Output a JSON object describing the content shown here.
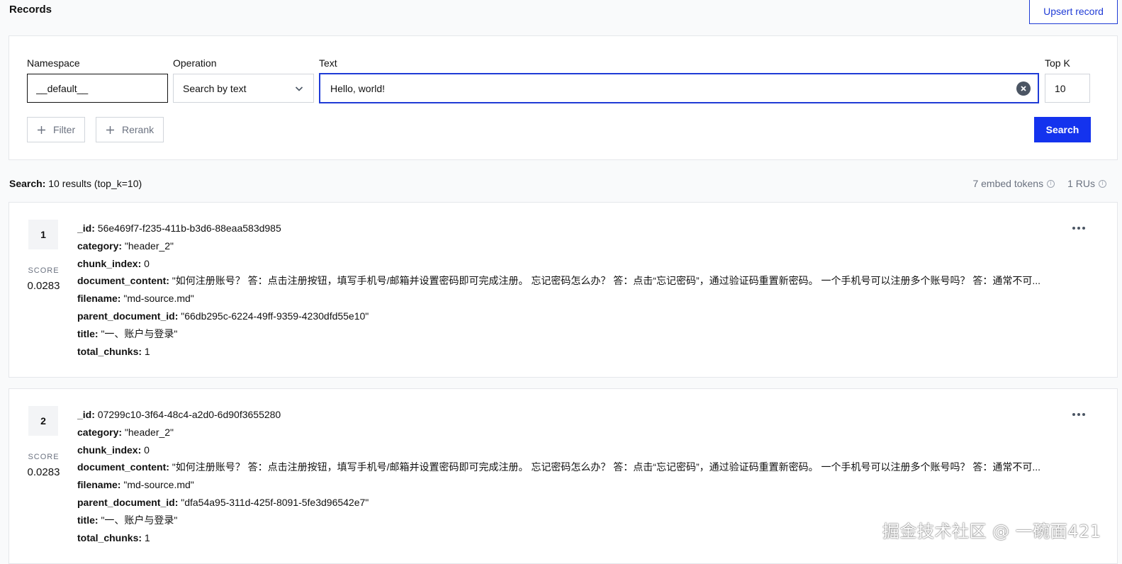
{
  "page": {
    "title": "Records",
    "upsert_label": "Upsert record"
  },
  "query": {
    "namespace_label": "Namespace",
    "namespace_value": "__default__",
    "operation_label": "Operation",
    "operation_value": "Search by text",
    "text_label": "Text",
    "text_value": "Hello, world!",
    "topk_label": "Top K",
    "topk_value": "10",
    "filter_label": "Filter",
    "rerank_label": "Rerank",
    "search_label": "Search"
  },
  "summary": {
    "prefix": "Search:",
    "text": " 10 results (top_k=10)",
    "embed_tokens": "7 embed tokens",
    "rus": "1 RUs"
  },
  "results": [
    {
      "rank": "1",
      "score_label": "SCORE",
      "score": "0.0283",
      "fields": [
        {
          "key": "_id:",
          "value": " 56e469f7-f235-411b-b3d6-88eaa583d985"
        },
        {
          "key": "category:",
          "value": " \"header_2\""
        },
        {
          "key": "chunk_index:",
          "value": " 0"
        },
        {
          "key": "document_content:",
          "value": " \"如何注册账号？ 答：点击注册按钮，填写手机号/邮箱并设置密码即可完成注册。 忘记密码怎么办？ 答：点击“忘记密码”，通过验证码重置新密码。 一个手机号可以注册多个账号吗？ 答：通常不可..."
        },
        {
          "key": "filename:",
          "value": " \"md-source.md\""
        },
        {
          "key": "parent_document_id:",
          "value": " \"66db295c-6224-49ff-9359-4230dfd55e10\""
        },
        {
          "key": "title:",
          "value": " \"一、账户与登录\""
        },
        {
          "key": "total_chunks:",
          "value": " 1"
        }
      ]
    },
    {
      "rank": "2",
      "score_label": "SCORE",
      "score": "0.0283",
      "fields": [
        {
          "key": "_id:",
          "value": " 07299c10-3f64-48c4-a2d0-6d90f3655280"
        },
        {
          "key": "category:",
          "value": " \"header_2\""
        },
        {
          "key": "chunk_index:",
          "value": " 0"
        },
        {
          "key": "document_content:",
          "value": " \"如何注册账号？ 答：点击注册按钮，填写手机号/邮箱并设置密码即可完成注册。 忘记密码怎么办？ 答：点击“忘记密码”，通过验证码重置新密码。 一个手机号可以注册多个账号吗？ 答：通常不可..."
        },
        {
          "key": "filename:",
          "value": " \"md-source.md\""
        },
        {
          "key": "parent_document_id:",
          "value": " \"dfa54a95-311d-425f-8091-5fe3d96542e7\""
        },
        {
          "key": "title:",
          "value": " \"一、账户与登录\""
        },
        {
          "key": "total_chunks:",
          "value": " 1"
        }
      ]
    }
  ],
  "watermark": "掘金技术社区 @ 一碗面421",
  "colors": {
    "accent": "#1433ee",
    "border_accent": "#1f3bd6"
  }
}
